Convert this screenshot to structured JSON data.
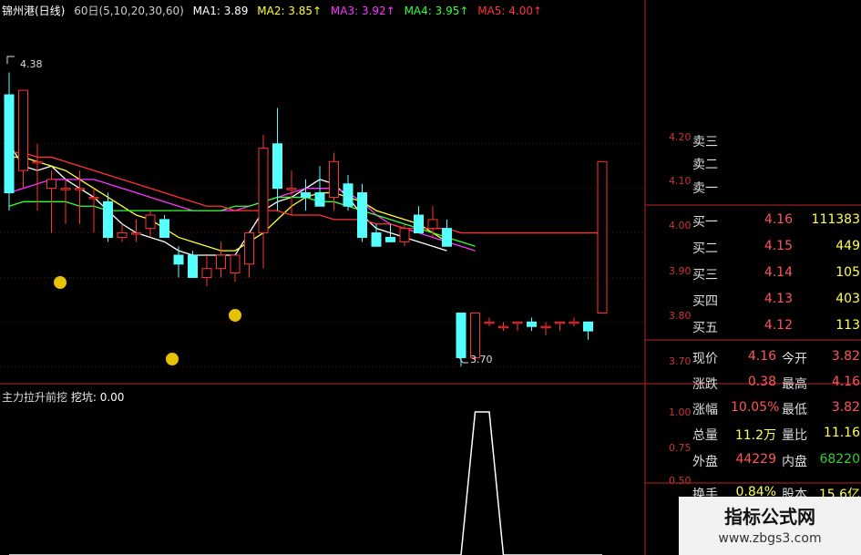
{
  "header": {
    "title": "锦州港(日线)",
    "params": "60日(5,10,20,30,60)",
    "ma": [
      {
        "label": "MA1: 3.89",
        "color": "#ffffff"
      },
      {
        "label": "MA2: 3.85↑",
        "color": "#ffff33"
      },
      {
        "label": "MA3: 3.92↑",
        "color": "#ff33ff"
      },
      {
        "label": "MA4: 3.95↑",
        "color": "#33ff33"
      },
      {
        "label": "MA5: 4.00↑",
        "color": "#ff3333"
      }
    ]
  },
  "price_axis": [
    "4.20",
    "4.10",
    "4.00",
    "3.90",
    "3.80",
    "3.70"
  ],
  "annotations": {
    "high": "4.38",
    "low": "3.70"
  },
  "sub_panel": {
    "label": "主力拉升前挖",
    "value_label": "挖坑: 0.00",
    "axis": [
      "1.00",
      "0.75",
      "0.50"
    ]
  },
  "quote": {
    "asks": [
      {
        "label": "卖三"
      },
      {
        "label": "卖二"
      },
      {
        "label": "卖一"
      }
    ],
    "bids": [
      {
        "label": "买一",
        "price": "4.16",
        "vol": "111383"
      },
      {
        "label": "买二",
        "price": "4.15",
        "vol": "449"
      },
      {
        "label": "买三",
        "price": "4.14",
        "vol": "105"
      },
      {
        "label": "买四",
        "price": "4.13",
        "vol": "403"
      },
      {
        "label": "买五",
        "price": "4.12",
        "vol": "113"
      }
    ],
    "stats": [
      {
        "l1": "现价",
        "v1": "4.16",
        "l2": "今开",
        "v2": "3.82"
      },
      {
        "l1": "涨跌",
        "v1": "0.38",
        "l2": "最高",
        "v2": "4.16"
      },
      {
        "l1": "涨幅",
        "v1": "10.05%",
        "l2": "最低",
        "v2": "3.82"
      },
      {
        "l1": "总量",
        "v1": "11.2万",
        "l2": "量比",
        "v2": "11.16"
      },
      {
        "l1": "外盘",
        "v1": "44229",
        "l2": "内盘",
        "v2": "68220"
      },
      {
        "l1": "换手",
        "v1": "0.84%",
        "l2": "股本",
        "v2": "15.6亿"
      }
    ]
  },
  "watermark": {
    "title": "指标公式网",
    "url": "www.zbgs3.com"
  },
  "chart_data": {
    "type": "candlestick",
    "y_range": [
      3.68,
      4.4
    ],
    "candles": [
      {
        "o": 4.31,
        "h": 4.36,
        "l": 4.05,
        "c": 4.09
      },
      {
        "o": 4.14,
        "h": 4.32,
        "l": 4.1,
        "c": 4.32
      },
      {
        "o": 4.16,
        "h": 4.2,
        "l": 4.05,
        "c": 4.16
      },
      {
        "o": 4.1,
        "h": 4.14,
        "l": 4.0,
        "c": 4.12
      },
      {
        "o": 4.1,
        "h": 4.12,
        "l": 4.02,
        "c": 4.1
      },
      {
        "o": 4.1,
        "h": 4.14,
        "l": 4.02,
        "c": 4.1
      },
      {
        "o": 4.08,
        "h": 4.1,
        "l": 4.0,
        "c": 4.08
      },
      {
        "o": 4.07,
        "h": 4.09,
        "l": 3.98,
        "c": 3.99
      },
      {
        "o": 3.99,
        "h": 4.02,
        "l": 3.98,
        "c": 4.0
      },
      {
        "o": 4.0,
        "h": 4.03,
        "l": 3.98,
        "c": 4.0
      },
      {
        "o": 4.01,
        "h": 4.05,
        "l": 3.99,
        "c": 4.04
      },
      {
        "o": 4.03,
        "h": 4.04,
        "l": 3.99,
        "c": 3.99
      },
      {
        "o": 3.95,
        "h": 3.97,
        "l": 3.9,
        "c": 3.93
      },
      {
        "o": 3.95,
        "h": 3.96,
        "l": 3.9,
        "c": 3.9
      },
      {
        "o": 3.9,
        "h": 3.95,
        "l": 3.88,
        "c": 3.92
      },
      {
        "o": 3.92,
        "h": 3.98,
        "l": 3.9,
        "c": 3.95
      },
      {
        "o": 3.91,
        "h": 3.94,
        "l": 3.89,
        "c": 3.95
      },
      {
        "o": 3.93,
        "h": 4.0,
        "l": 3.9,
        "c": 4.0
      },
      {
        "o": 4.0,
        "h": 4.22,
        "l": 3.92,
        "c": 4.19
      },
      {
        "o": 4.2,
        "h": 4.28,
        "l": 4.05,
        "c": 4.1
      },
      {
        "o": 4.1,
        "h": 4.14,
        "l": 4.04,
        "c": 4.1
      },
      {
        "o": 4.09,
        "h": 4.12,
        "l": 4.05,
        "c": 4.08
      },
      {
        "o": 4.09,
        "h": 4.15,
        "l": 4.06,
        "c": 4.06
      },
      {
        "o": 4.08,
        "h": 4.18,
        "l": 4.05,
        "c": 4.16
      },
      {
        "o": 4.11,
        "h": 4.13,
        "l": 4.05,
        "c": 4.06
      },
      {
        "o": 4.09,
        "h": 4.11,
        "l": 3.98,
        "c": 3.99
      },
      {
        "o": 4.0,
        "h": 4.02,
        "l": 3.97,
        "c": 3.97
      },
      {
        "o": 3.99,
        "h": 4.02,
        "l": 3.98,
        "c": 3.98
      },
      {
        "o": 3.98,
        "h": 4.02,
        "l": 3.97,
        "c": 4.01
      },
      {
        "o": 4.04,
        "h": 4.06,
        "l": 4.0,
        "c": 4.0
      },
      {
        "o": 4.01,
        "h": 4.06,
        "l": 3.99,
        "c": 4.03
      },
      {
        "o": 4.01,
        "h": 4.03,
        "l": 3.97,
        "c": 3.97
      },
      {
        "o": 3.82,
        "h": 3.82,
        "l": 3.7,
        "c": 3.72
      },
      {
        "o": 3.72,
        "h": 3.82,
        "l": 3.71,
        "c": 3.82
      },
      {
        "o": 3.8,
        "h": 3.81,
        "l": 3.79,
        "c": 3.8
      },
      {
        "o": 3.79,
        "h": 3.8,
        "l": 3.78,
        "c": 3.79
      },
      {
        "o": 3.8,
        "h": 3.8,
        "l": 3.78,
        "c": 3.8
      },
      {
        "o": 3.8,
        "h": 3.81,
        "l": 3.78,
        "c": 3.79
      },
      {
        "o": 3.79,
        "h": 3.8,
        "l": 3.77,
        "c": 3.79
      },
      {
        "o": 3.8,
        "h": 3.8,
        "l": 3.78,
        "c": 3.8
      },
      {
        "o": 3.8,
        "h": 3.81,
        "l": 3.79,
        "c": 3.8
      },
      {
        "o": 3.8,
        "h": 3.8,
        "l": 3.76,
        "c": 3.78
      },
      {
        "o": 3.82,
        "h": 4.16,
        "l": 3.82,
        "c": 4.16
      }
    ],
    "ma_lines": [
      {
        "name": "MA1",
        "color": "#ffffff",
        "values": [
          4.2,
          4.15,
          4.14,
          4.15,
          4.12,
          4.1,
          4.08,
          4.05,
          4.02,
          4.0,
          3.99,
          3.98,
          3.96,
          3.95,
          3.95,
          3.95,
          3.95,
          4.0,
          4.05,
          4.07,
          4.08,
          4.1,
          4.12,
          4.11,
          4.08,
          4.04,
          4.01,
          4.0,
          3.99,
          3.98,
          3.97,
          3.96
        ]
      },
      {
        "name": "MA2",
        "color": "#ffff33",
        "values": [
          4.17,
          4.17,
          4.16,
          4.15,
          4.14,
          4.12,
          4.1,
          4.08,
          4.06,
          4.04,
          4.03,
          4.01,
          3.99,
          3.98,
          3.97,
          3.96,
          3.96,
          3.98,
          4.0,
          4.03,
          4.06,
          4.08,
          4.09,
          4.09,
          4.08,
          4.07,
          4.05,
          4.04,
          4.03,
          4.02,
          4.0,
          3.98
        ]
      },
      {
        "name": "MA3",
        "color": "#ff33ff",
        "values": [
          4.09,
          4.1,
          4.11,
          4.12,
          4.12,
          4.12,
          4.12,
          4.11,
          4.1,
          4.09,
          4.08,
          4.07,
          4.06,
          4.05,
          4.05,
          4.05,
          4.05,
          4.06,
          4.07,
          4.08,
          4.09,
          4.1,
          4.1,
          4.1,
          4.09,
          4.07,
          4.04,
          4.02,
          4.01,
          4.0,
          3.99,
          3.98,
          3.97,
          3.96
        ]
      },
      {
        "name": "MA4",
        "color": "#33ff33",
        "values": [
          4.06,
          4.07,
          4.07,
          4.07,
          4.07,
          4.06,
          4.06,
          4.05,
          4.05,
          4.05,
          4.05,
          4.05,
          4.05,
          4.05,
          4.05,
          4.05,
          4.06,
          4.06,
          4.07,
          4.08,
          4.08,
          4.08,
          4.07,
          4.07,
          4.06,
          4.05,
          4.04,
          4.03,
          4.02,
          4.01,
          4.0,
          3.99,
          3.98,
          3.97
        ]
      },
      {
        "name": "MA5",
        "color": "#ff3333",
        "values": [
          4.18,
          4.18,
          4.17,
          4.17,
          4.16,
          4.15,
          4.14,
          4.13,
          4.12,
          4.11,
          4.1,
          4.09,
          4.08,
          4.07,
          4.06,
          4.06,
          4.05,
          4.05,
          4.05,
          4.05,
          4.04,
          4.04,
          4.04,
          4.03,
          4.03,
          4.03,
          4.02,
          4.02,
          4.01,
          4.01,
          4.01,
          4.01,
          4.0,
          4.0,
          4.0,
          4.0,
          4.0,
          4.0,
          4.0,
          4.0,
          4.0,
          4.0,
          4.0
        ]
      }
    ],
    "indicator": {
      "name": "挖坑",
      "values": [
        0,
        0,
        0,
        0,
        0,
        0,
        0,
        0,
        0,
        0,
        0,
        0,
        0,
        0,
        0,
        0,
        0,
        0,
        0,
        0,
        0,
        0,
        0,
        0,
        0,
        0,
        0,
        0,
        0,
        0,
        0,
        0,
        0,
        1,
        1,
        0,
        0,
        0,
        0,
        0,
        0,
        0,
        0
      ]
    }
  }
}
